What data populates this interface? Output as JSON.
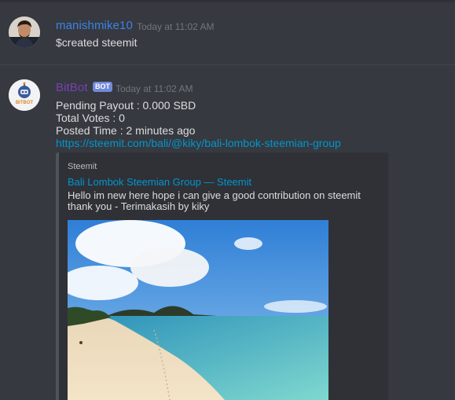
{
  "messages": [
    {
      "username": "manishmike10",
      "timestamp": "Today at 11:02 AM",
      "content": "$created steemit",
      "avatar_icon": "user-avatar-photo"
    },
    {
      "username": "BitBot",
      "bot_tag": "BOT",
      "timestamp": "Today at 11:02 AM",
      "avatar_icon": "bitbot-robot-logo",
      "avatar_text": "BITBOT",
      "lines": [
        "Pending Payout : 0.000 SBD",
        "Total Votes : 0",
        "Posted Time : 2 minutes ago"
      ],
      "link": "https://steemit.com/bali/@kiky/bali-lombok-steemian-group",
      "embed": {
        "provider": "Steemit",
        "title": "Bali Lombok Steemian Group — Steemit",
        "description": "Hello im new here hope i can give a good contribution on steemit thank you - Terimakasih by kiky",
        "image_icon": "beach-photo"
      }
    }
  ],
  "colors": {
    "background": "#36393f",
    "username_user": "#3d82e7",
    "username_bot": "#7b3fb6",
    "bot_tag": "#7289da",
    "link": "#0096cf",
    "embed_bg": "#2f3136"
  }
}
